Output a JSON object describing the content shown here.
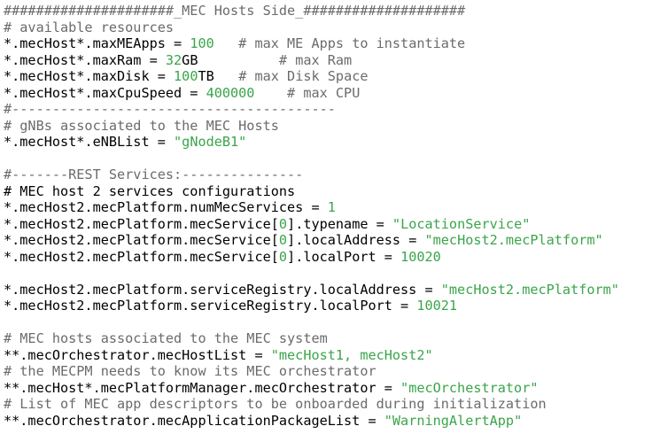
{
  "lines": [
    [
      {
        "t": "#####################_MEC Hosts Side_####################",
        "k": "c"
      }
    ],
    [
      {
        "t": "# available resources",
        "k": "c"
      }
    ],
    [
      {
        "t": "*.mecHost*.maxMEApps = ",
        "k": "k"
      },
      {
        "t": "100",
        "k": "n"
      },
      {
        "t": "   # max ME Apps to instantiate",
        "k": "c"
      }
    ],
    [
      {
        "t": "*.mecHost*.maxRam = ",
        "k": "k"
      },
      {
        "t": "32",
        "k": "n"
      },
      {
        "t": "GB",
        "k": "k"
      },
      {
        "t": "          # max Ram",
        "k": "c"
      }
    ],
    [
      {
        "t": "*.mecHost*.maxDisk = ",
        "k": "k"
      },
      {
        "t": "100",
        "k": "n"
      },
      {
        "t": "TB",
        "k": "k"
      },
      {
        "t": "   # max Disk Space",
        "k": "c"
      }
    ],
    [
      {
        "t": "*.mecHost*.maxCpuSpeed = ",
        "k": "k"
      },
      {
        "t": "400000",
        "k": "n"
      },
      {
        "t": "    # max CPU",
        "k": "c"
      }
    ],
    [
      {
        "t": "#----------------------------------------",
        "k": "c"
      }
    ],
    [
      {
        "t": "# gNBs associated to the MEC Hosts",
        "k": "c"
      }
    ],
    [
      {
        "t": "*.mecHost*.eNBList = ",
        "k": "k"
      },
      {
        "t": "\"gNodeB1\"",
        "k": "s"
      }
    ],
    [],
    [
      {
        "t": "#-------REST Services:---------------",
        "k": "c"
      }
    ],
    [
      {
        "t": "# MEC host 2 services configurations",
        "k": "k"
      }
    ],
    [
      {
        "t": "*.mecHost2.mecPlatform.numMecServices = ",
        "k": "k"
      },
      {
        "t": "1",
        "k": "n"
      }
    ],
    [
      {
        "t": "*.mecHost2.mecPlatform.mecService[",
        "k": "k"
      },
      {
        "t": "0",
        "k": "n"
      },
      {
        "t": "].typename = ",
        "k": "k"
      },
      {
        "t": "\"LocationService\"",
        "k": "s"
      }
    ],
    [
      {
        "t": "*.mecHost2.mecPlatform.mecService[",
        "k": "k"
      },
      {
        "t": "0",
        "k": "n"
      },
      {
        "t": "].localAddress = ",
        "k": "k"
      },
      {
        "t": "\"mecHost2.mecPlatform\"",
        "k": "s"
      }
    ],
    [
      {
        "t": "*.mecHost2.mecPlatform.mecService[",
        "k": "k"
      },
      {
        "t": "0",
        "k": "n"
      },
      {
        "t": "].localPort = ",
        "k": "k"
      },
      {
        "t": "10020",
        "k": "n"
      }
    ],
    [],
    [
      {
        "t": "*.mecHost2.mecPlatform.serviceRegistry.localAddress = ",
        "k": "k"
      },
      {
        "t": "\"mecHost2.mecPlatform\"",
        "k": "s"
      }
    ],
    [
      {
        "t": "*.mecHost2.mecPlatform.serviceRegistry.localPort = ",
        "k": "k"
      },
      {
        "t": "10021",
        "k": "n"
      }
    ],
    [],
    [
      {
        "t": "# MEC hosts associated to the MEC system",
        "k": "c"
      }
    ],
    [
      {
        "t": "**.mecOrchestrator.mecHostList = ",
        "k": "k"
      },
      {
        "t": "\"mecHost1, mecHost2\"",
        "k": "s"
      }
    ],
    [
      {
        "t": "# the MECPM needs to know its MEC orchestrator",
        "k": "c"
      }
    ],
    [
      {
        "t": "**.mecHost*.mecPlatformManager.mecOrchestrator = ",
        "k": "k"
      },
      {
        "t": "\"mecOrchestrator\"",
        "k": "s"
      }
    ],
    [
      {
        "t": "# List of MEC app descriptors to be onboarded during initialization",
        "k": "c"
      }
    ],
    [
      {
        "t": "**.mecOrchestrator.mecApplicationPackageList = ",
        "k": "k"
      },
      {
        "t": "\"WarningAlertApp\"",
        "k": "s"
      }
    ]
  ]
}
